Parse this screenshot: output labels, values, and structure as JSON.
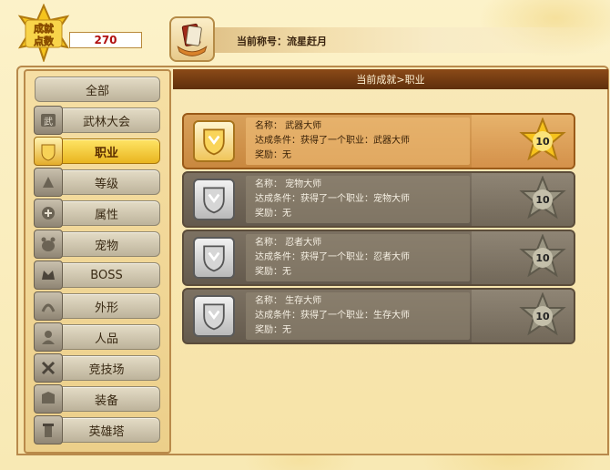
{
  "header": {
    "badge_text": "成就点数",
    "points": "270",
    "current_title_label": "当前称号：流星赶月"
  },
  "sidebar": {
    "items": [
      {
        "label": "全部",
        "icon": "none",
        "active": false
      },
      {
        "label": "武林大会",
        "icon": "martial-arts-icon",
        "active": false
      },
      {
        "label": "职业",
        "icon": "job-icon",
        "active": true
      },
      {
        "label": "等级",
        "icon": "level-icon",
        "active": false
      },
      {
        "label": "属性",
        "icon": "attribute-icon",
        "active": false
      },
      {
        "label": "宠物",
        "icon": "pet-icon",
        "active": false
      },
      {
        "label": "BOSS",
        "icon": "boss-icon",
        "active": false
      },
      {
        "label": "外形",
        "icon": "appearance-icon",
        "active": false
      },
      {
        "label": "人品",
        "icon": "character-icon",
        "active": false
      },
      {
        "label": "竞技场",
        "icon": "arena-icon",
        "active": false
      },
      {
        "label": "装备",
        "icon": "equipment-icon",
        "active": false
      },
      {
        "label": "英雄塔",
        "icon": "hero-tower-icon",
        "active": false
      }
    ]
  },
  "content": {
    "breadcrumb": "当前成就>职业",
    "achievements": [
      {
        "name": "名称： 武器大师",
        "condition": "达成条件：获得了一个职业：武器大师",
        "reward": "奖励：无",
        "points": "10",
        "unlocked": true
      },
      {
        "name": "名称： 宠物大师",
        "condition": "达成条件：获得了一个职业：宠物大师",
        "reward": "奖励：无",
        "points": "10",
        "unlocked": false
      },
      {
        "name": "名称： 忍者大师",
        "condition": "达成条件：获得了一个职业：忍者大师",
        "reward": "奖励：无",
        "points": "10",
        "unlocked": false
      },
      {
        "name": "名称： 生存大师",
        "condition": "达成条件：获得了一个职业：生存大师",
        "reward": "奖励：无",
        "points": "10",
        "unlocked": false
      }
    ]
  },
  "colors": {
    "active_tab": "#f0c032",
    "header_bar": "#6e3a12",
    "points_text": "#b01010",
    "gold_star": "#f6c21c",
    "locked_star": "#9a9582"
  }
}
